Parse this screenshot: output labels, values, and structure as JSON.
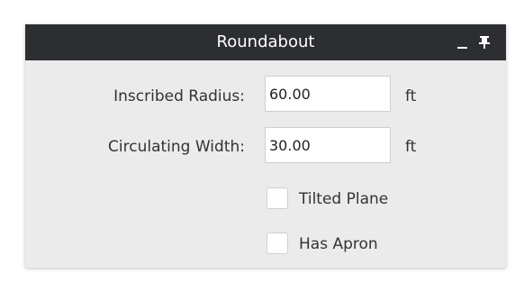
{
  "panel": {
    "title": "Roundabout",
    "minimize_icon": "minimize-icon",
    "pin_icon": "pin-icon"
  },
  "fields": {
    "inscribed_radius": {
      "label": "Inscribed Radius:",
      "value": "60.00",
      "unit": "ft"
    },
    "circulating_width": {
      "label": "Circulating Width:",
      "value": "30.00",
      "unit": "ft"
    }
  },
  "options": {
    "tilted_plane": {
      "label": "Tilted Plane",
      "checked": false
    },
    "has_apron": {
      "label": "Has Apron",
      "checked": false
    }
  },
  "colors": {
    "titlebar_bg": "#2c2e31",
    "panel_bg": "#ebebeb"
  }
}
